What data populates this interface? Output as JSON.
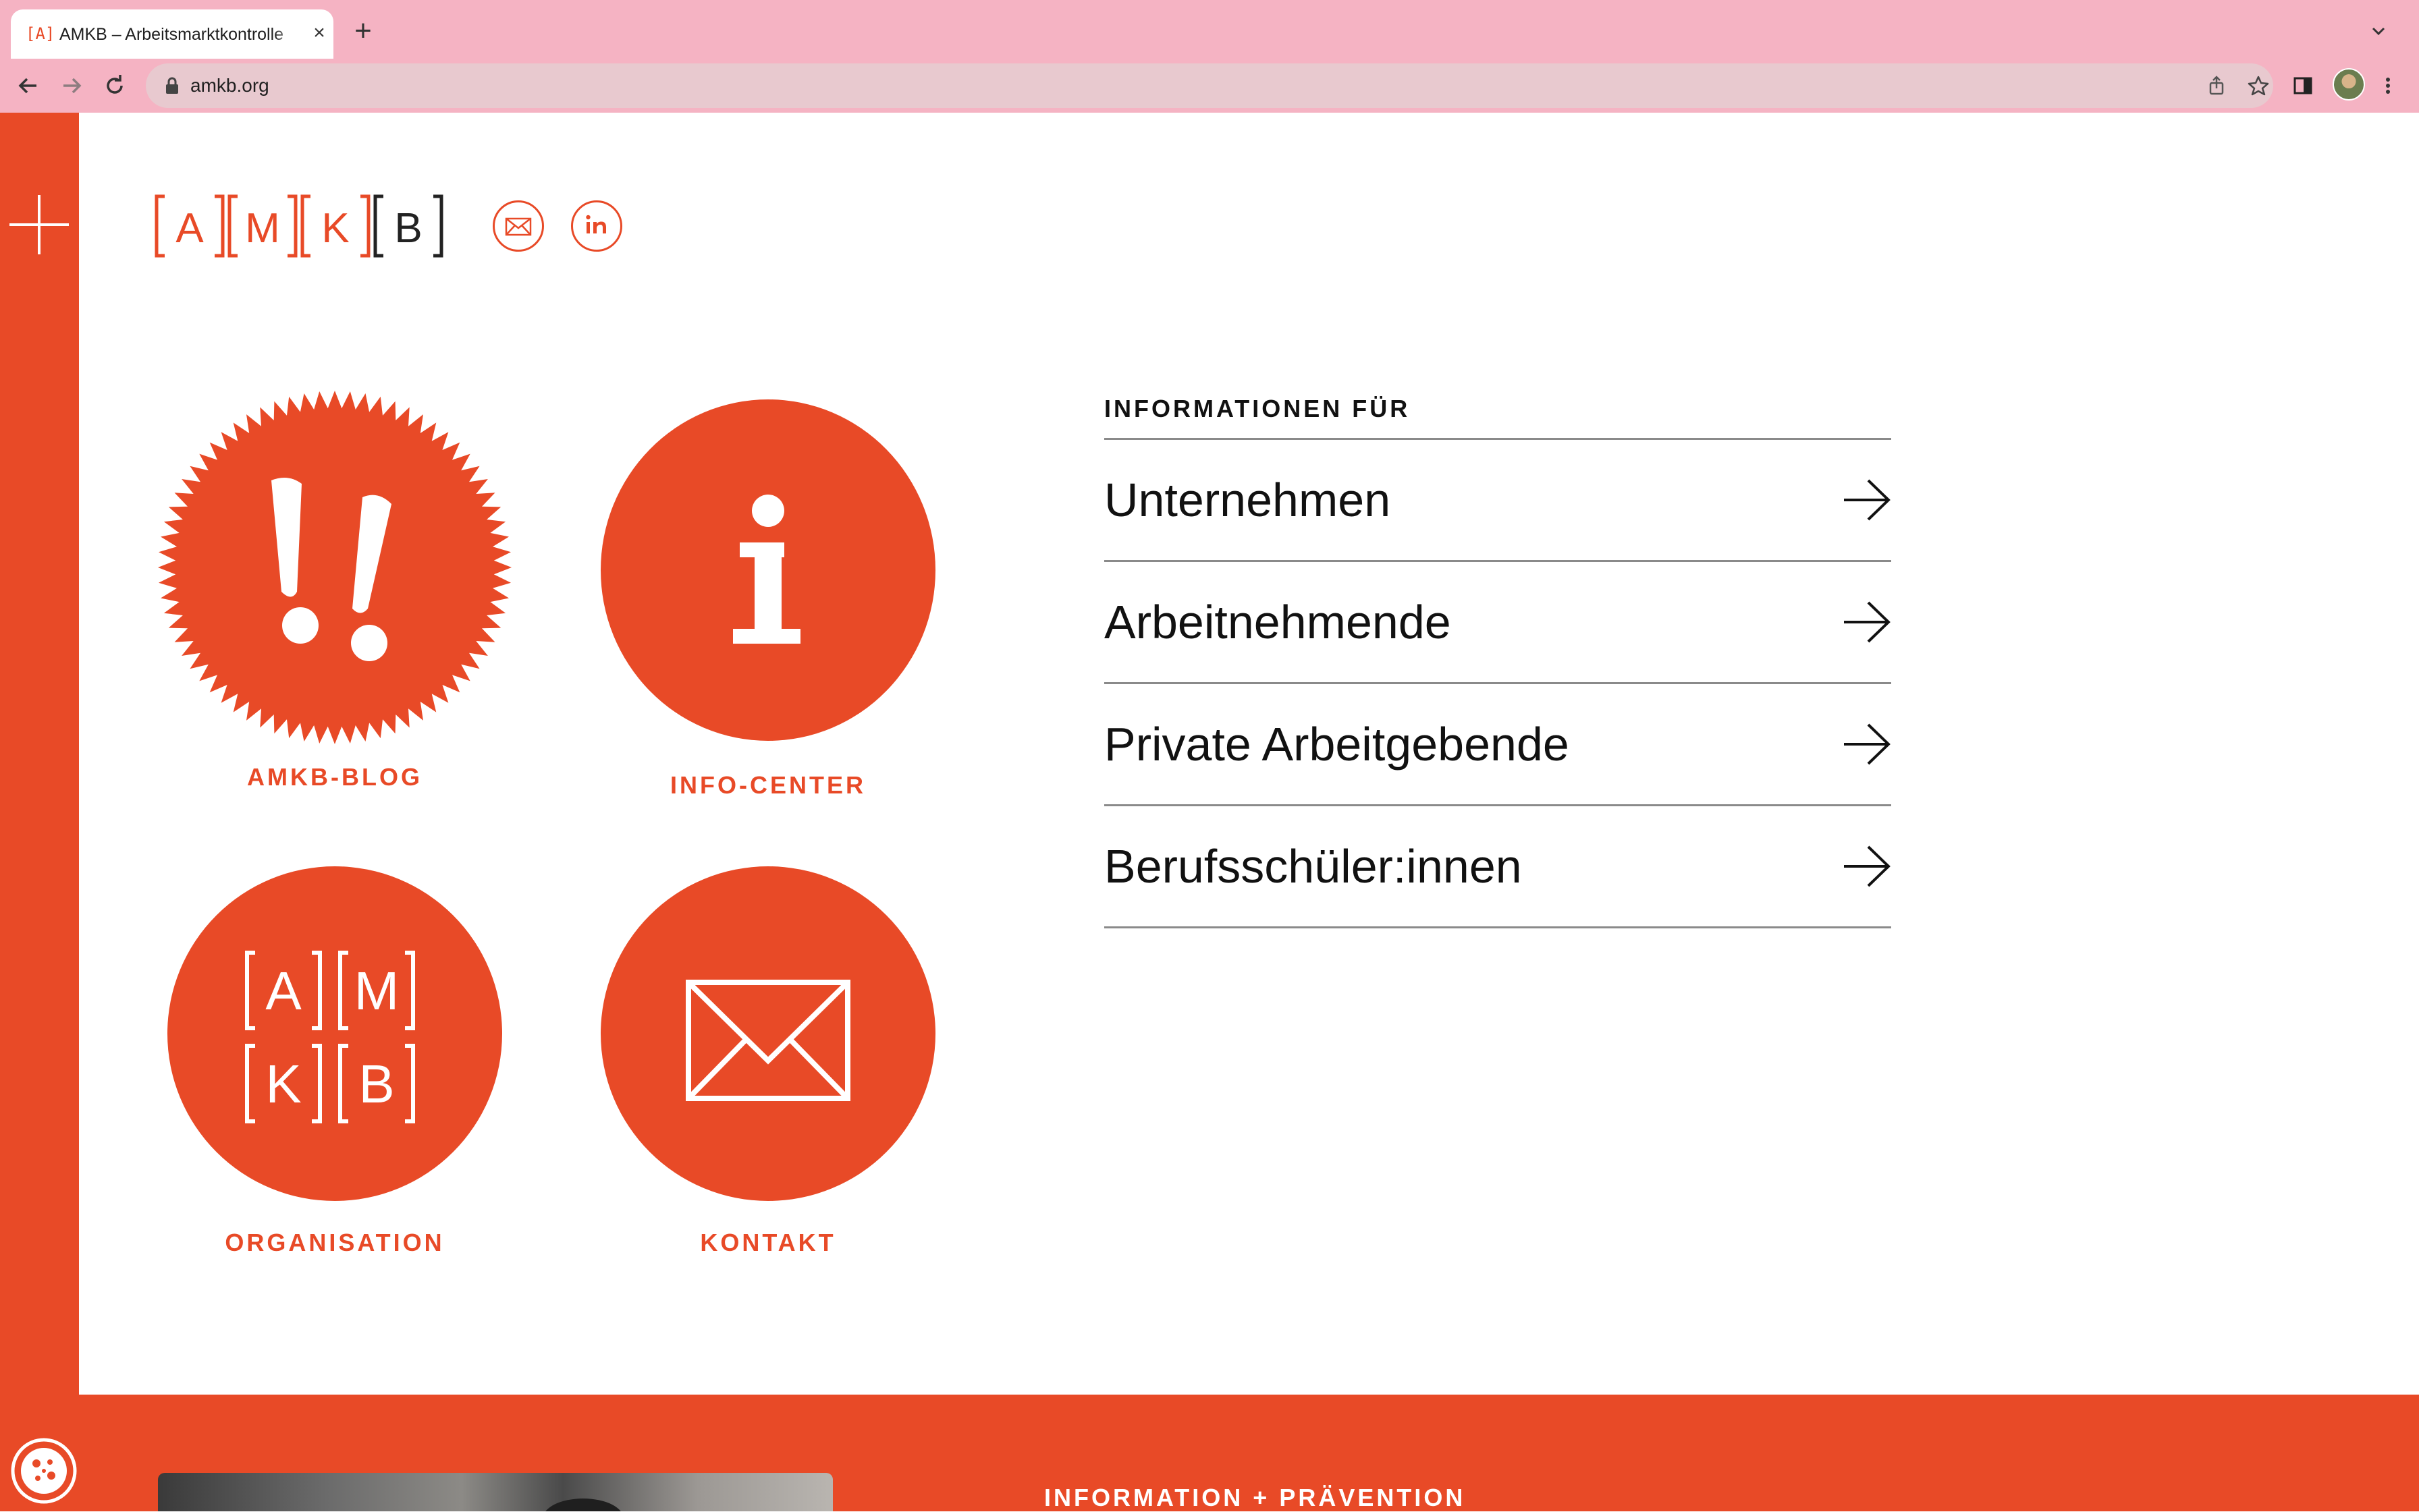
{
  "colors": {
    "brand": "#e84a27",
    "chrome": "#f5b3c3",
    "omnibox": "#e8c9cf",
    "text": "#111111"
  },
  "browser": {
    "tab": {
      "favicon_text": "[A]",
      "title": "AMKB – Arbeitsmarktkontrolle",
      "close_icon": "close-icon"
    },
    "new_tab_label": "+",
    "back_icon": "arrow-left-icon",
    "forward_icon": "arrow-right-icon",
    "reload_icon": "reload-icon",
    "url": "amkb.org",
    "omnibox_icons": [
      "share-icon",
      "star-icon"
    ],
    "toolbar_icons": [
      "side-panel-icon",
      "profile-avatar",
      "more-vert-icon"
    ]
  },
  "header": {
    "logo_letters": [
      "A",
      "M",
      "K",
      "B"
    ],
    "social_icons": [
      "mail-icon",
      "linkedin-icon"
    ]
  },
  "tiles": [
    {
      "id": "blog",
      "label": "AMKB-BLOG",
      "icon": "exclamation-badge-icon"
    },
    {
      "id": "info",
      "label": "INFO-CENTER",
      "icon": "info-icon"
    },
    {
      "id": "org",
      "label": "ORGANISATION",
      "icon": "amkb-logo-icon"
    },
    {
      "id": "contact",
      "label": "KONTAKT",
      "icon": "envelope-icon"
    }
  ],
  "info_for": {
    "heading": "INFORMATIONEN FÜR",
    "items": [
      {
        "label": "Unternehmen"
      },
      {
        "label": "Arbeitnehmende"
      },
      {
        "label": "Private Arbeitgebende"
      },
      {
        "label": "Berufsschüler:innen"
      }
    ]
  },
  "footer_band": {
    "heading": "INFORMATION + PRÄVENTION"
  }
}
